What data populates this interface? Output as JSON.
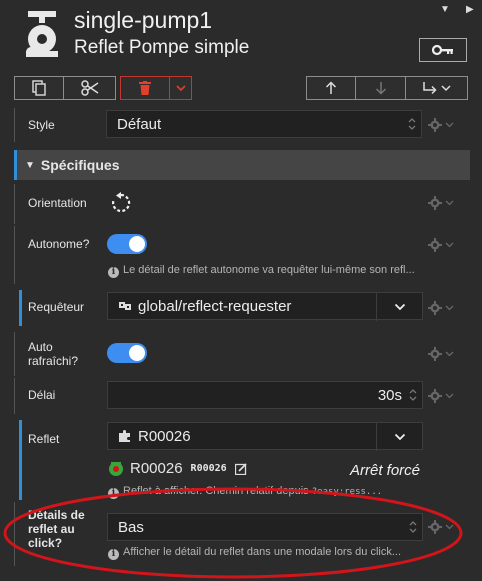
{
  "header": {
    "title": "single-pump1",
    "subtitle": "Reflet Pompe simple",
    "key_icon": "key-icon",
    "menu_icon": "caret-down-icon",
    "side_icon": "caret-right-icon"
  },
  "toolbar": {
    "copy_icon": "copy-icon",
    "cut_icon": "scissors-icon",
    "delete_icon": "trash-icon",
    "delete_menu_icon": "chevron-down-icon",
    "move_up_icon": "arrow-up-icon",
    "move_down_icon": "arrow-down-icon",
    "move_into_icon": "arrow-turn-icon",
    "colors": {
      "danger": "#e0412b"
    }
  },
  "style_row": {
    "label": "Style",
    "value": "Défaut"
  },
  "section": {
    "label": "Spécifiques"
  },
  "orientation": {
    "label": "Orientation",
    "icon": "rotate-icon"
  },
  "autonome": {
    "label": "Autonome?",
    "checked": true,
    "hint": "Le détail de reflet autonome va requêter lui-même son refl..."
  },
  "requeteur": {
    "label": "Requêteur",
    "value": "global/reflect-requester"
  },
  "auto_refresh": {
    "label_line1": "Auto",
    "label_line2": "rafraîchi?",
    "checked": true
  },
  "delai": {
    "label": "Délai",
    "value": "30s"
  },
  "reflet": {
    "label": "Reflet",
    "value": "R00026",
    "preview_name": "R00026",
    "preview_code": "R00026",
    "status": "Arrêt forcé",
    "hint_prefix": "Reflet à afficher. Chemin relatif depuis",
    "hint_code": "?easy:ress..."
  },
  "details_click": {
    "label_line1": "Détails de",
    "label_line2": "reflet au",
    "label_line3": "click?",
    "value": "Bas",
    "hint": "Afficher le détail du reflet dans une modale lors du click..."
  },
  "colors": {
    "accent": "#2f8fd8",
    "toggle": "#3d8ef0",
    "highlight": "#d1151a",
    "pump_green": "#3aa53a"
  }
}
